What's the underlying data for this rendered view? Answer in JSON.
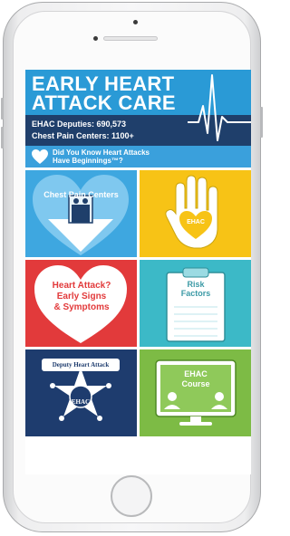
{
  "app": {
    "title": "EARLY HEART\nATTACK CARE",
    "deputies": "EHAC Deputies: 690,573",
    "centers": "Chest Pain Centers: 1100+",
    "did_you_know": "Did You Know Heart Attacks\nHave Beginnings™?"
  },
  "tiles": {
    "chest_pain_centers": {
      "label": "Chest Pain Centers"
    },
    "ehac_hand": {
      "label": "EHAC"
    },
    "early_signs": {
      "label": "Heart Attack?\nEarly Signs\n& Symptoms"
    },
    "risk_factors": {
      "label": "Risk\nFactors"
    },
    "deputy": {
      "label": "Deputy Heart Attack",
      "badge": "EHAC"
    },
    "course": {
      "label": "EHAC\nCourse"
    }
  },
  "colors": {
    "banner_blue": "#2a9ad6",
    "stats_navy": "#1f3f6b",
    "tile_blue": "#3ea7e0",
    "tile_yellow": "#f7c316",
    "tile_red": "#e23a3b",
    "tile_teal": "#3cb9c7",
    "tile_navy": "#1e3c6e",
    "tile_green": "#7dbb45"
  },
  "icons": {
    "heart": "heart-icon",
    "hand": "hand-icon",
    "clipboard": "clipboard-icon",
    "badge": "sheriff-star-icon",
    "monitor": "monitor-icon",
    "ecg": "ecg-line-icon"
  }
}
